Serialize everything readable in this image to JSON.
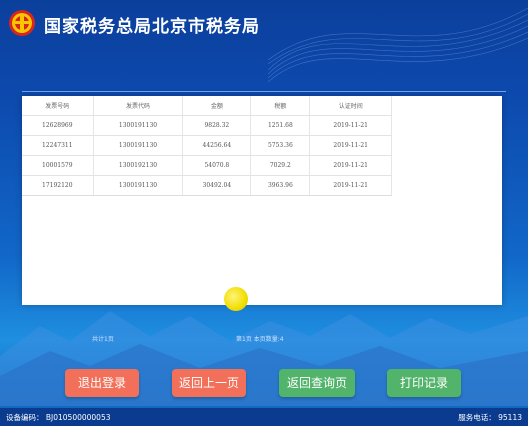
{
  "header": {
    "title": "国家税务总局北京市税务局",
    "emblem_icon": "tax-bureau-emblem-icon"
  },
  "table": {
    "columns": [
      "发票号码",
      "发票代码",
      "金额",
      "税额",
      "认证时间"
    ],
    "rows": [
      [
        "12628969",
        "1300191130",
        "9828.32",
        "1251.68",
        "2019-11-21"
      ],
      [
        "12247311",
        "1300191130",
        "44256.64",
        "5753.36",
        "2019-11-21"
      ],
      [
        "10001579",
        "1300192130",
        "54070.8",
        "7029.2",
        "2019-11-21"
      ],
      [
        "17192120",
        "1300191130",
        "30492.04",
        "3963.96",
        "2019-11-21"
      ]
    ]
  },
  "pager": {
    "total_text": "共计1页",
    "page_text": "第1页 本页数量:4"
  },
  "buttons": {
    "logout": "退出登录",
    "back": "返回上一页",
    "query": "返回查询页",
    "print": "打印记录"
  },
  "footer": {
    "device": "设备编码： BJ010500000053",
    "hotline": "服务电话： 95113"
  },
  "colors": {
    "red_button": "#f2705a",
    "green_button": "#52b36b",
    "header_blue": "#0b3f9c"
  }
}
